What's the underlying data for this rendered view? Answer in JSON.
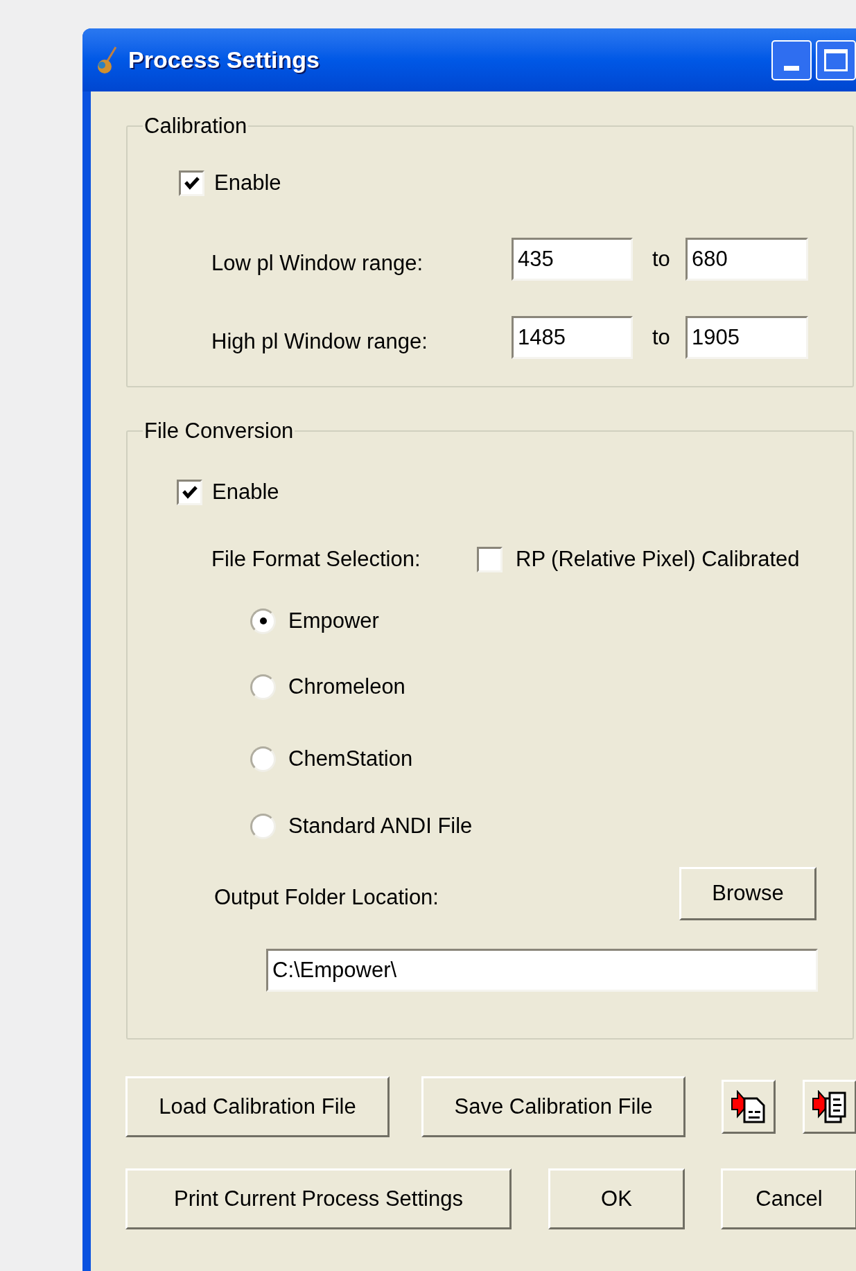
{
  "window": {
    "title": "Process Settings"
  },
  "calibration": {
    "title": "Calibration",
    "enable": {
      "label": "Enable",
      "checked": true
    },
    "ranges": [
      {
        "label": "Low pl Window range:",
        "from": "435",
        "separator": "to",
        "to": "680"
      },
      {
        "label": "High pl Window range:",
        "from": "1485",
        "separator": "to",
        "to": "1905"
      }
    ]
  },
  "file_conversion": {
    "title": "File Conversion",
    "enable": {
      "label": "Enable",
      "checked": true
    },
    "format_label": "File Format Selection:",
    "rp_option": {
      "label": "RP (Relative Pixel) Calibrated",
      "checked": false
    },
    "formats": [
      {
        "label": "Empower",
        "selected": true
      },
      {
        "label": "Chromeleon",
        "selected": false
      },
      {
        "label": "ChemStation",
        "selected": false
      },
      {
        "label": "Standard ANDI File",
        "selected": false
      }
    ],
    "output_label": "Output Folder Location:",
    "browse_button": "Browse",
    "output_path": "C:\\Empower\\"
  },
  "buttons_row_1": [
    {
      "kind": "text",
      "label": "Load Calibration File"
    },
    {
      "kind": "text",
      "label": "Save Calibration File"
    },
    {
      "kind": "import_single"
    },
    {
      "kind": "import_multiple"
    }
  ],
  "buttons_row_2": [
    {
      "label": "Print Current Process Settings"
    },
    {
      "label": "OK"
    },
    {
      "label": "Cancel"
    }
  ]
}
